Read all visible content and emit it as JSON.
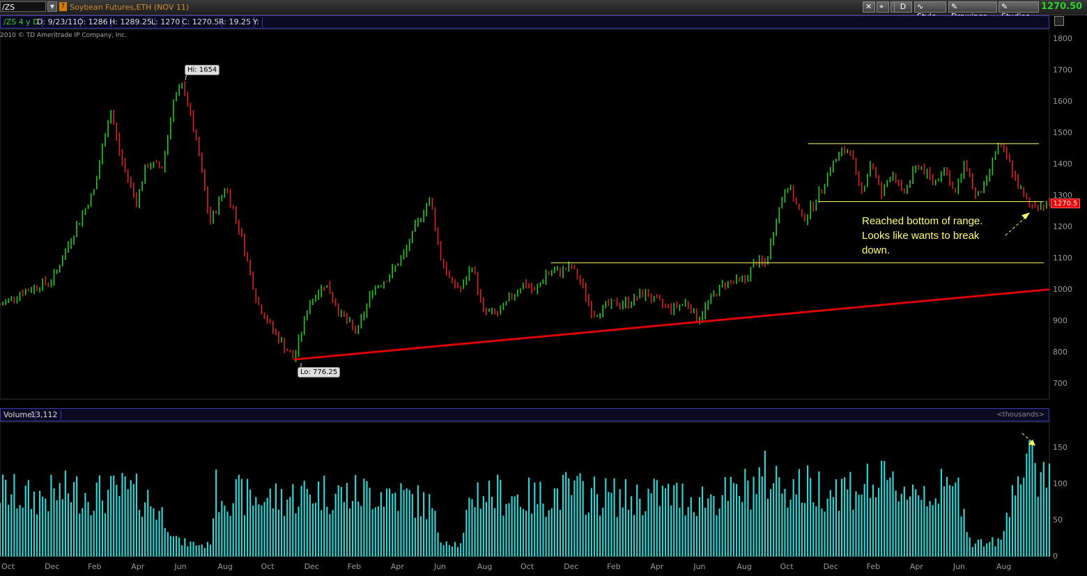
{
  "toolbar": {
    "symbol": "/ZS",
    "description": "Soybean Futures,ETH (NOV 11)",
    "aggregation": "D",
    "style_label": "Style",
    "drawings_label": "Drawings",
    "studies_label": "Studies",
    "last_price": "1270.50",
    "warn_glyph": "?"
  },
  "info": {
    "instrument": "/ZS 4 y D",
    "date": "D: 9/23/11",
    "open": "O: 1286",
    "high": "H: 1289.25",
    "low": "L: 1270",
    "close": "C: 1270.5",
    "range": "R: 19.25",
    "y": "Y:"
  },
  "copyright": "2010 © TD Ameritrade IP Company, Inc.",
  "price_axis": [
    "1800",
    "1700",
    "1600",
    "1500",
    "1400",
    "1300",
    "1200",
    "1100",
    "1000",
    "900",
    "800",
    "700"
  ],
  "price_tag": "1270.5",
  "callouts": {
    "hi": "Hi: 1654",
    "lo": "Lo: 776.25"
  },
  "annotation": [
    "Reached bottom of range.",
    "Looks like wants to break",
    "down."
  ],
  "volume": {
    "label": "Volume",
    "value": "13,112",
    "unit": "<thousands>",
    "axis": [
      "150",
      "100",
      "50",
      "0"
    ]
  },
  "x_axis": [
    "Oct",
    "Dec",
    "Feb",
    "Apr",
    "Jun",
    "Aug",
    "Oct",
    "Dec",
    "Feb",
    "Apr",
    "Jun",
    "Aug",
    "Oct",
    "Dec",
    "Feb",
    "Apr",
    "Jun",
    "Aug",
    "Oct",
    "Dec",
    "Feb",
    "Apr",
    "Jun",
    "Aug"
  ],
  "colors": {
    "up": "#22cc22",
    "down": "#dd2222",
    "line": "#ffff66",
    "trend": "#dd0000",
    "volume": "#2ed3d3"
  },
  "chart_data": {
    "type": "candlestick",
    "ylim": [
      650,
      1830
    ],
    "volume_ylim": [
      0,
      185
    ],
    "price_anchors": [
      [
        0,
        950
      ],
      [
        0.02,
        990
      ],
      [
        0.05,
        1030
      ],
      [
        0.07,
        1180
      ],
      [
        0.09,
        1320
      ],
      [
        0.105,
        1580
      ],
      [
        0.115,
        1420
      ],
      [
        0.13,
        1280
      ],
      [
        0.14,
        1400
      ],
      [
        0.155,
        1390
      ],
      [
        0.165,
        1600
      ],
      [
        0.175,
        1654
      ],
      [
        0.19,
        1420
      ],
      [
        0.2,
        1210
      ],
      [
        0.215,
        1330
      ],
      [
        0.23,
        1170
      ],
      [
        0.245,
        960
      ],
      [
        0.26,
        870
      ],
      [
        0.28,
        776.25
      ],
      [
        0.295,
        960
      ],
      [
        0.31,
        1020
      ],
      [
        0.325,
        920
      ],
      [
        0.34,
        860
      ],
      [
        0.355,
        1000
      ],
      [
        0.37,
        1040
      ],
      [
        0.385,
        1110
      ],
      [
        0.4,
        1230
      ],
      [
        0.41,
        1290
      ],
      [
        0.42,
        1100
      ],
      [
        0.43,
        1020
      ],
      [
        0.44,
        1000
      ],
      [
        0.45,
        1080
      ],
      [
        0.46,
        930
      ],
      [
        0.475,
        920
      ],
      [
        0.49,
        990
      ],
      [
        0.5,
        1020
      ],
      [
        0.51,
        990
      ],
      [
        0.52,
        1050
      ],
      [
        0.535,
        1060
      ],
      [
        0.545,
        1070
      ],
      [
        0.555,
        1010
      ],
      [
        0.565,
        920
      ],
      [
        0.58,
        950
      ],
      [
        0.6,
        960
      ],
      [
        0.615,
        990
      ],
      [
        0.625,
        960
      ],
      [
        0.64,
        940
      ],
      [
        0.655,
        960
      ],
      [
        0.665,
        900
      ],
      [
        0.675,
        960
      ],
      [
        0.69,
        1020
      ],
      [
        0.71,
        1030
      ],
      [
        0.72,
        1090
      ],
      [
        0.73,
        1080
      ],
      [
        0.74,
        1230
      ],
      [
        0.75,
        1340
      ],
      [
        0.765,
        1220
      ],
      [
        0.78,
        1300
      ],
      [
        0.79,
        1380
      ],
      [
        0.8,
        1430
      ],
      [
        0.81,
        1450
      ],
      [
        0.82,
        1300
      ],
      [
        0.83,
        1410
      ],
      [
        0.84,
        1300
      ],
      [
        0.85,
        1380
      ],
      [
        0.86,
        1300
      ],
      [
        0.875,
        1400
      ],
      [
        0.89,
        1340
      ],
      [
        0.9,
        1390
      ],
      [
        0.91,
        1300
      ],
      [
        0.92,
        1410
      ],
      [
        0.93,
        1290
      ],
      [
        0.94,
        1340
      ],
      [
        0.95,
        1460
      ],
      [
        0.96,
        1420
      ],
      [
        0.97,
        1330
      ],
      [
        0.98,
        1270.5
      ]
    ],
    "volume_profile": [
      [
        0,
        90
      ],
      [
        0.03,
        80
      ],
      [
        0.07,
        90
      ],
      [
        0.1,
        85
      ],
      [
        0.12,
        90
      ],
      [
        0.14,
        80
      ],
      [
        0.16,
        50
      ],
      [
        0.17,
        20
      ],
      [
        0.2,
        15
      ],
      [
        0.205,
        90
      ],
      [
        0.24,
        80
      ],
      [
        0.27,
        80
      ],
      [
        0.3,
        90
      ],
      [
        0.33,
        85
      ],
      [
        0.36,
        90
      ],
      [
        0.38,
        85
      ],
      [
        0.41,
        70
      ],
      [
        0.42,
        25
      ],
      [
        0.44,
        15
      ],
      [
        0.45,
        90
      ],
      [
        0.48,
        85
      ],
      [
        0.51,
        80
      ],
      [
        0.54,
        90
      ],
      [
        0.57,
        85
      ],
      [
        0.6,
        80
      ],
      [
        0.63,
        85
      ],
      [
        0.66,
        80
      ],
      [
        0.7,
        85
      ],
      [
        0.73,
        110
      ],
      [
        0.76,
        95
      ],
      [
        0.8,
        95
      ],
      [
        0.83,
        100
      ],
      [
        0.86,
        95
      ],
      [
        0.89,
        90
      ],
      [
        0.915,
        90
      ],
      [
        0.925,
        20
      ],
      [
        0.955,
        20
      ],
      [
        0.965,
        110
      ],
      [
        0.98,
        120
      ]
    ],
    "horizontal_lines": [
      1465,
      1280,
      1085
    ],
    "support_line": [
      [
        0.28,
        776.25
      ],
      [
        1.0,
        1000
      ]
    ]
  }
}
